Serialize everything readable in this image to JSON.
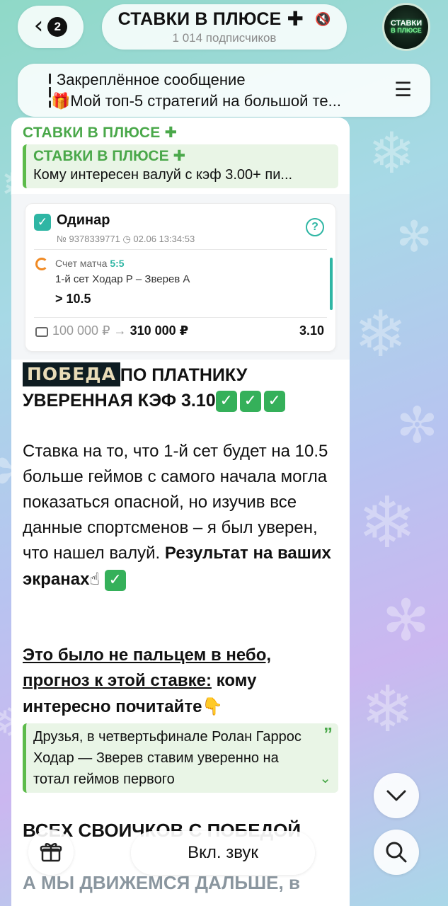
{
  "header": {
    "back_count": "2",
    "channel_title": "СТАВКИ В ПЛЮСЕ",
    "subscribers": "1 014 подписчиков",
    "avatar_line1": "СТАВКИ",
    "avatar_line2": "В ПЛЮСЕ",
    "icons": {
      "back": "chevron-left-icon",
      "mute": "mute-icon",
      "plus": "heavy-plus-icon"
    }
  },
  "pinned": {
    "title": "Закреплённое сообщение",
    "text": "🎁Мой топ-5 стратегий на большой те...",
    "icon": "pin-list-icon"
  },
  "message": {
    "sender": "СТАВКИ В ПЛЮСЕ",
    "forward": {
      "title": "СТАВКИ В ПЛЮСЕ",
      "text": "Кому интересен валуй с кэф 3.00+ пи..."
    },
    "bet_card": {
      "type": "Одинар",
      "meta": "№ 9378339771  ◷ 02.06 13:34:53",
      "score_label": "Счет матча",
      "score_value": "5:5",
      "match": "1-й сет Ходар Р – Зверев А",
      "selection": "> 10.5",
      "stake": "100 000 ₽",
      "arrow": "→",
      "payout": "310 000 ₽",
      "odds": "3.10"
    },
    "win_badge": "ПОБЕДА",
    "win_text_1": "ПО ПЛАТНИКУ",
    "win_text_2": "УВЕРЕННАЯ КЭФ 3.10",
    "body_plain": "Ставка на то, что 1-й сет будет на 10.5 больше геймов с самого начала могла показаться опасной, но изучив все данные спортсменов – я был уверен, что нашел валуй.",
    "body_bold": "Результат на ваших экранах",
    "underline_text": "Это было не пальцем в небо, прогноз к этой ставке:",
    "bold_after": "кому интересно почитайте",
    "quote": "Друзья, в четвертьфинале Ролан Гаррос Ходар — Зверев ставим уверенно на тотал геймов первого",
    "faded_line_1": "ВСЕХ СВОИЧКОВ С ПОБЕДОЙ",
    "faded_line_2": "А МЫ ДВИЖЕМСЯ ДАЛЬШЕ, в"
  },
  "controls": {
    "sound_button": "Вкл. звук"
  },
  "colors": {
    "accent_green": "#4aa84a",
    "teal": "#2fb6a4",
    "check_green": "#35b05a"
  }
}
